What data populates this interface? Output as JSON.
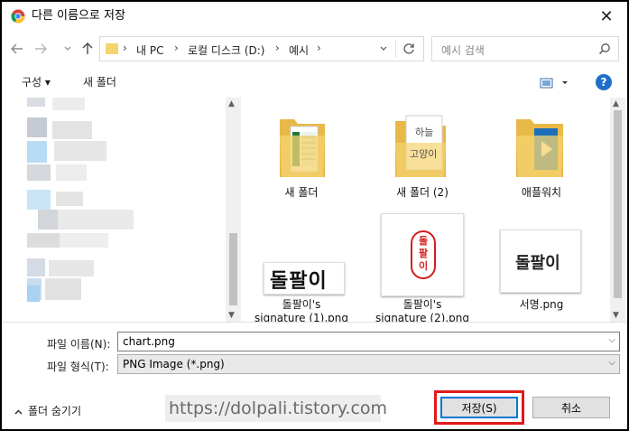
{
  "window": {
    "title": "다른 이름으로 저장",
    "close_label": "✕"
  },
  "navigation": {
    "back_icon": "arrow-left-icon",
    "forward_icon": "arrow-right-icon",
    "recent_icon": "chevron-down-icon",
    "up_icon": "arrow-up-icon"
  },
  "address": {
    "breadcrumbs": [
      "내 PC",
      "로컬 디스크 (D:)",
      "예시"
    ],
    "separator": "›"
  },
  "search": {
    "placeholder": "예시 검색"
  },
  "toolbar": {
    "organize_label": "구성 ▾",
    "new_folder_label": "새 폴더",
    "help_label": "?"
  },
  "files": [
    {
      "name": "새 폴더",
      "kind": "folder-excel"
    },
    {
      "name": "새 폴더 (2)",
      "kind": "folder-handwriting"
    },
    {
      "name": "애플워치",
      "kind": "folder-blue"
    },
    {
      "name": "돌팔이's signature (1).png",
      "line1": "돌팔이's",
      "line2": "signature (1).png",
      "kind": "image-signature",
      "image_text": "돌팔이"
    },
    {
      "name": "돌팔이's signature (2).png",
      "line1": "돌팔이's",
      "line2": "signature (2).png",
      "kind": "image-seal",
      "image_text": "돌팔이"
    },
    {
      "name": "서명.png",
      "kind": "image-signature",
      "image_text": "돌팔이"
    }
  ],
  "handwriting_folder_text": [
    "하늘",
    "고양이"
  ],
  "form": {
    "filename_label": "파일 이름(N):",
    "filename_value": "chart.png",
    "filetype_label": "파일 형식(T):",
    "filetype_value": "PNG Image (*.png)"
  },
  "footer": {
    "hide_folders_label": "폴더 숨기기",
    "watermark": "https://dolpali.tistory.com",
    "save_label": "저장(S)",
    "cancel_label": "취소"
  },
  "colors": {
    "accent": "#0078d7",
    "highlight_box": "#e11a1a",
    "folder": "#f5d36f",
    "help": "#1e6fc7"
  }
}
